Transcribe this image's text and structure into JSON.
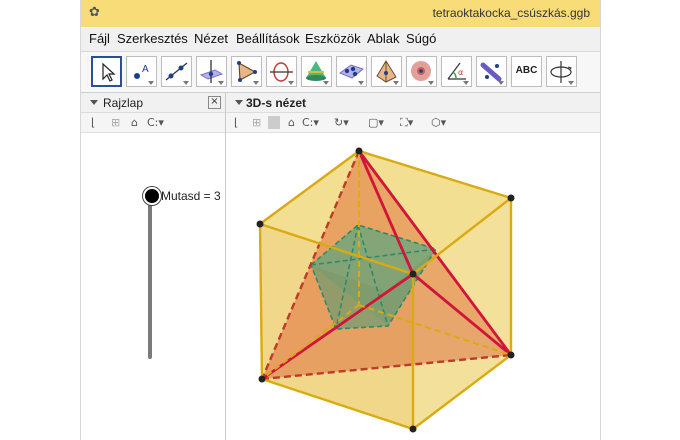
{
  "window": {
    "title": "tetraoktakocka_csúszkás.ggb"
  },
  "menu": {
    "items": [
      "Fájl",
      "Szerkesztés",
      "Nézet",
      "Beállítások",
      "Eszközök",
      "Ablak",
      "Súgó"
    ]
  },
  "toolbar": {
    "tools": [
      {
        "name": "move-tool",
        "icon": "cursor-arrow-icon",
        "active": true
      },
      {
        "name": "point-tool",
        "icon": "point-a-icon"
      },
      {
        "name": "line-tool",
        "icon": "line-through-points-icon"
      },
      {
        "name": "perpendicular-tool",
        "icon": "perpendicular-plane-icon"
      },
      {
        "name": "polygon-tool",
        "icon": "triangle-icon"
      },
      {
        "name": "circle-axis-tool",
        "icon": "circle-axis-icon"
      },
      {
        "name": "intersect-surfaces-tool",
        "icon": "cone-icon"
      },
      {
        "name": "plane-tool",
        "icon": "plane-points-icon"
      },
      {
        "name": "pyramid-tool",
        "icon": "pyramid-icon"
      },
      {
        "name": "sphere-tool",
        "icon": "sphere-icon"
      },
      {
        "name": "angle-tool",
        "icon": "angle-icon"
      },
      {
        "name": "reflect-tool",
        "icon": "reflect-plane-icon"
      },
      {
        "name": "text-tool",
        "icon": "text-abc-icon",
        "label": "ABC"
      },
      {
        "name": "rotate-view-tool",
        "icon": "rotate-view-icon"
      }
    ]
  },
  "left_panel": {
    "title": "Rajzlap",
    "slider": {
      "label": "Mutasd = 3",
      "value_fraction": 0
    }
  },
  "right_panel": {
    "title": "3D-s nézet"
  },
  "colors": {
    "titlebar": "#f8dc78",
    "cube_fill": "#e8c437",
    "cube_edge": "#d9aa12",
    "tetra_fill": "#e0703a",
    "tetra_edge": "#d0143a",
    "octa_fill": "#31a88a"
  }
}
